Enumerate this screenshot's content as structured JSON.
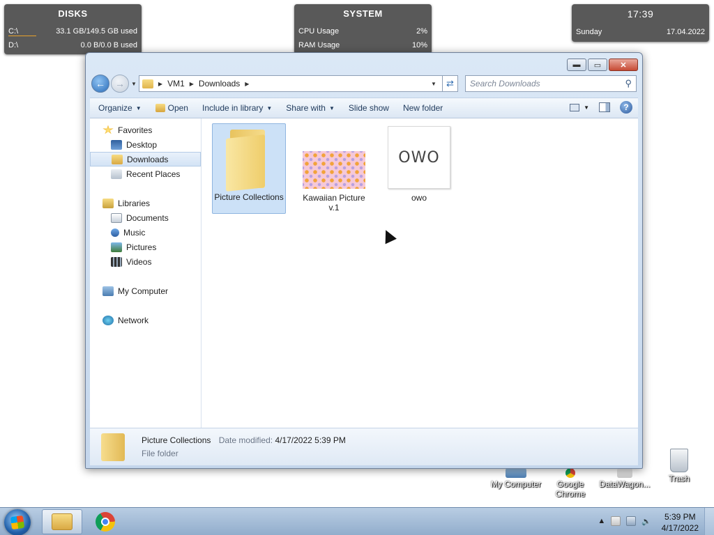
{
  "widgets": {
    "disks": {
      "title": "DISKS",
      "rows": [
        {
          "label": "C:\\",
          "value": "33.1 GB/149.5 GB used",
          "usage": 0.22
        },
        {
          "label": "D:\\",
          "value": "0.0 B/0.0 B used",
          "usage": 0
        }
      ]
    },
    "system": {
      "title": "SYSTEM",
      "rows": [
        {
          "label": "CPU Usage",
          "value": "2%"
        },
        {
          "label": "RAM Usage",
          "value": "10%"
        }
      ]
    },
    "clock": {
      "time": "17:39",
      "day": "Sunday",
      "date": "17.04.2022"
    }
  },
  "desktop_icons": [
    "My Computer",
    "Google Chrome",
    "DataWagon...",
    "Trash"
  ],
  "window": {
    "address": {
      "parts": [
        "VM1",
        "Downloads"
      ]
    },
    "search": {
      "placeholder": "Search Downloads"
    },
    "commands": {
      "organize": "Organize",
      "open": "Open",
      "include": "Include in library",
      "share": "Share with",
      "slideshow": "Slide show",
      "new_folder": "New folder"
    },
    "nav": {
      "favorites": "Favorites",
      "desktop": "Desktop",
      "downloads": "Downloads",
      "recent": "Recent Places",
      "libraries": "Libraries",
      "documents": "Documents",
      "music": "Music",
      "pictures": "Pictures",
      "videos": "Videos",
      "computer": "My Computer",
      "network": "Network"
    },
    "files": [
      {
        "name": "Picture Collections",
        "type": "folder",
        "selected": true
      },
      {
        "name": "Kawaiian Picture v.1",
        "type": "image"
      },
      {
        "name": "owo",
        "type": "image",
        "thumb_text": "OWO"
      }
    ],
    "details": {
      "name": "Picture Collections",
      "date_label": "Date modified:",
      "date_value": "4/17/2022 5:39 PM",
      "type": "File folder"
    }
  },
  "taskbar": {
    "time": "5:39 PM",
    "date": "4/17/2022"
  },
  "colors": {
    "accent": "#2a6cb8",
    "selection": "#cce1f7",
    "widget_bar": "#e9a12c"
  }
}
